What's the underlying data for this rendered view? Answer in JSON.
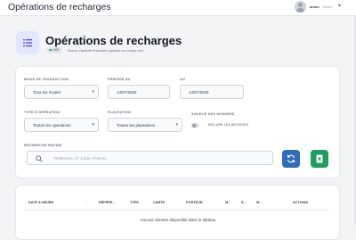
{
  "topbar": {
    "app_title": "Opérations de recharges",
    "user_name": "amou",
    "user_role": "Admin"
  },
  "header": {
    "title": "Opérations de recharges",
    "badge": "LIVE",
    "subtitle": "Suivez l'activité financière globale en temps réel"
  },
  "filters": {
    "mode_label": "MODE DE TRANSACTION",
    "mode_value": "Tous les modes",
    "from_label": "PÉRIODE DU",
    "from_value": "14/07/2026",
    "to_label": "AU",
    "to_value": "14/07/2026",
    "type_label": "TYPE D'OPÉRATION",
    "type_value": "Toutes les operations",
    "plantation_label": "PLANTATION",
    "plantation_value": "Toutes les plantations",
    "source_label": "SOURCE DES DONNÉES",
    "archives_label": "INCLURE LES ARCHIVES",
    "search_label": "RECHERCHE RAPIDE",
    "search_placeholder": "Référence, N° Carte, Porteur..."
  },
  "table": {
    "columns": [
      "DATE & HEURE",
      "RÉFÉRE...",
      "TYPE",
      "CARTE",
      "PORTEUR",
      "M...",
      "S...",
      "M...",
      "ACTIONS"
    ],
    "empty_message": "Aucune donnée disponible dans le tableau"
  },
  "colors": {
    "accent": "#2f6db6",
    "export": "#1f9d5c",
    "header_icon_bg": "#e0e7ff"
  },
  "icons": {
    "header": "list-icon",
    "search": "search-icon",
    "refresh": "refresh-icon",
    "export": "excel-export-icon"
  }
}
